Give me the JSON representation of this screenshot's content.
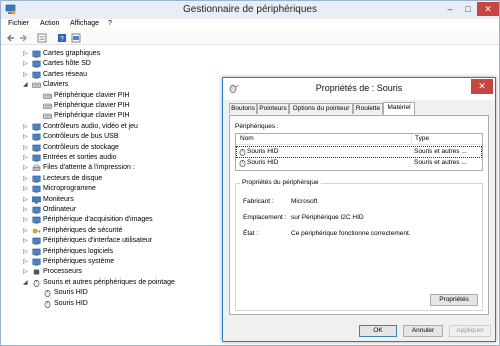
{
  "main_window": {
    "title": "Gestionnaire de périphériques",
    "controls": {
      "minimize": "–",
      "maximize": "□",
      "close": "✕"
    }
  },
  "menu": [
    "Fichier",
    "Action",
    "Affichage",
    "?"
  ],
  "toolbar": [
    "back-icon",
    "forward-icon",
    "properties-icon",
    "help-icon",
    "view-icon"
  ],
  "tree": [
    {
      "label": "Cartes graphiques",
      "level": 1,
      "expander": "▷",
      "icon": "display-adapter-icon"
    },
    {
      "label": "Cartes hôte SD",
      "level": 1,
      "expander": "▷",
      "icon": "sd-host-icon"
    },
    {
      "label": "Cartes réseau",
      "level": 1,
      "expander": "▷",
      "icon": "network-adapter-icon"
    },
    {
      "label": "Claviers",
      "level": 1,
      "expander": "◢",
      "icon": "keyboard-icon"
    },
    {
      "label": "Périphérique clavier PIH",
      "level": 2,
      "expander": "",
      "icon": "keyboard-icon"
    },
    {
      "label": "Périphérique clavier PIH",
      "level": 2,
      "expander": "",
      "icon": "keyboard-icon"
    },
    {
      "label": "Périphérique clavier PIH",
      "level": 2,
      "expander": "",
      "icon": "keyboard-icon"
    },
    {
      "label": "Contrôleurs audio, vidéo et jeu",
      "level": 1,
      "expander": "▷",
      "icon": "audio-icon"
    },
    {
      "label": "Contrôleurs de bus USB",
      "level": 1,
      "expander": "▷",
      "icon": "usb-icon"
    },
    {
      "label": "Contrôleurs de stockage",
      "level": 1,
      "expander": "▷",
      "icon": "storage-icon"
    },
    {
      "label": "Entrées et sorties audio",
      "level": 1,
      "expander": "▷",
      "icon": "audio-io-icon"
    },
    {
      "label": "Files d'attente à l'impression :",
      "level": 1,
      "expander": "▷",
      "icon": "printer-icon"
    },
    {
      "label": "Lecteurs de disque",
      "level": 1,
      "expander": "▷",
      "icon": "disk-drive-icon"
    },
    {
      "label": "Microprogramme",
      "level": 1,
      "expander": "▷",
      "icon": "firmware-icon"
    },
    {
      "label": "Moniteurs",
      "level": 1,
      "expander": "▷",
      "icon": "monitor-icon"
    },
    {
      "label": "Ordinateur",
      "level": 1,
      "expander": "▷",
      "icon": "computer-icon"
    },
    {
      "label": "Périphérique d'acquisition d'images",
      "level": 1,
      "expander": "▷",
      "icon": "camera-icon"
    },
    {
      "label": "Périphériques de sécurité",
      "level": 1,
      "expander": "▷",
      "icon": "security-key-icon"
    },
    {
      "label": "Périphériques d'interface utilisateur",
      "level": 1,
      "expander": "▷",
      "icon": "hid-icon"
    },
    {
      "label": "Périphériques logiciels",
      "level": 1,
      "expander": "▷",
      "icon": "software-device-icon"
    },
    {
      "label": "Périphériques système",
      "level": 1,
      "expander": "▷",
      "icon": "system-device-icon"
    },
    {
      "label": "Processeurs",
      "level": 1,
      "expander": "▷",
      "icon": "processor-icon"
    },
    {
      "label": "Souris et autres périphériques de pointage",
      "level": 1,
      "expander": "◢",
      "icon": "mouse-icon"
    },
    {
      "label": "Souris HID",
      "level": 2,
      "expander": "",
      "icon": "mouse-icon"
    },
    {
      "label": "Souris HID",
      "level": 2,
      "expander": "",
      "icon": "mouse-icon"
    }
  ],
  "dialog": {
    "title": "Propriétés de : Souris",
    "close": "✕",
    "tabs": [
      "Boutons",
      "Pointeurs",
      "Options du pointeur",
      "Roulette",
      "Matériel"
    ],
    "active_tab": "Matériel",
    "devices_label": "Périphériques :",
    "columns": [
      "Nom",
      "Type"
    ],
    "devices": [
      {
        "name": "Souris HID",
        "type": "Souris et autres ...",
        "selected": true
      },
      {
        "name": "Souris HID",
        "type": "Souris et autres ...",
        "selected": false
      }
    ],
    "properties_group": "Propriétés du périphérique",
    "properties": [
      {
        "label": "Fabricant :",
        "value": "Microsoft"
      },
      {
        "label": "Emplacement :",
        "value": "sur Périphérique I2C HID"
      },
      {
        "label": "État :",
        "value": "Ce périphérique fonctionne correctement."
      }
    ],
    "properties_button": "Propriétés",
    "buttons": {
      "ok": "OK",
      "cancel": "Annuler",
      "apply": "Appliquer"
    }
  },
  "colors": {
    "title_bar": "#e8eef6",
    "close_button": "#c7453e",
    "dialog_border": "#2b7bc4",
    "dialog_background": "#f0f0f0"
  }
}
